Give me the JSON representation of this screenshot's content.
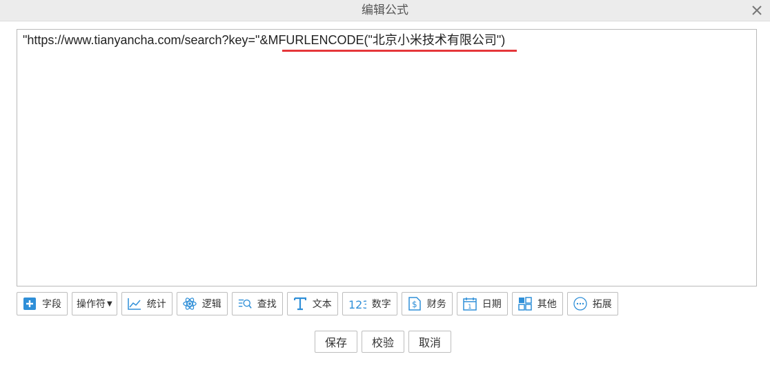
{
  "dialog": {
    "title": "编辑公式"
  },
  "editor": {
    "formula": "\"https://www.tianyancha.com/search?key=\"&MFURLENCODE(\"北京小米技术有限公司\")",
    "highlight_color": "#e5363a"
  },
  "toolbar": {
    "items": [
      {
        "label": "字段",
        "icon": "plus-square-icon"
      },
      {
        "label": "操作符",
        "icon": "caret-down-icon"
      },
      {
        "label": "统计",
        "icon": "line-chart-icon"
      },
      {
        "label": "逻辑",
        "icon": "atom-icon"
      },
      {
        "label": "查找",
        "icon": "search-list-icon"
      },
      {
        "label": "文本",
        "icon": "text-t-icon"
      },
      {
        "label": "数字",
        "icon": "number-123-icon"
      },
      {
        "label": "财务",
        "icon": "dollar-document-icon"
      },
      {
        "label": "日期",
        "icon": "calendar-icon"
      },
      {
        "label": "其他",
        "icon": "grid-icon"
      },
      {
        "label": "拓展",
        "icon": "ellipsis-circle-icon"
      }
    ]
  },
  "footer": {
    "save": "保存",
    "validate": "校验",
    "cancel": "取消"
  },
  "colors": {
    "accent": "#2f8fd8",
    "titlebar": "#ececec"
  }
}
